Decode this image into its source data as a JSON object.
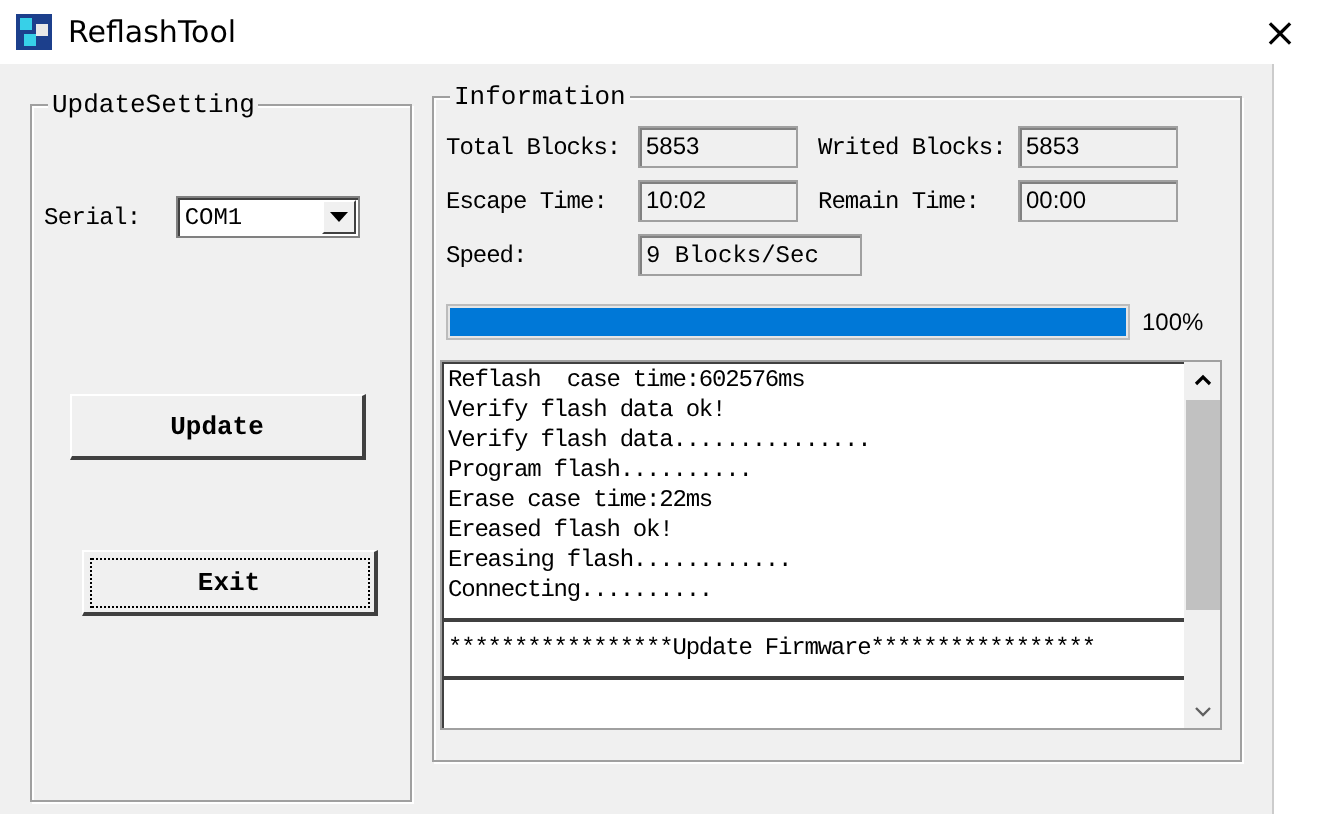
{
  "window": {
    "title": "ReflashTool",
    "close": "×"
  },
  "update_setting": {
    "title": "UpdateSetting",
    "serial_label": "Serial:",
    "serial_value": "COM1",
    "buttons": [
      {
        "label": "Update",
        "focused": false
      },
      {
        "label": "Exit",
        "focused": true
      }
    ]
  },
  "information": {
    "title": "Information",
    "fields": [
      {
        "label": "Total Blocks:",
        "value": "5853"
      },
      {
        "label": "Writed Blocks:",
        "value": "5853"
      },
      {
        "label": "Escape Time:",
        "value": "10:02"
      },
      {
        "label": "Remain Time:",
        "value": "00:00"
      },
      {
        "label": "Speed:",
        "value": "9 Blocks/Sec"
      }
    ],
    "progress": {
      "level": 1,
      "reading": "100%"
    },
    "log": [
      {
        "kind": "text",
        "text": "Reflash  case time:602576ms"
      },
      {
        "kind": "text",
        "text": "Verify flash data ok!"
      },
      {
        "kind": "text",
        "text": "Verify flash data..............."
      },
      {
        "kind": "text",
        "text": "Program flash.........."
      },
      {
        "kind": "text",
        "text": "Erase case time:22ms"
      },
      {
        "kind": "text",
        "text": "Ereased flash ok!"
      },
      {
        "kind": "text",
        "text": "Ereasing flash............"
      },
      {
        "kind": "text",
        "text": "Connecting.........."
      },
      {
        "kind": "rule"
      },
      {
        "kind": "text",
        "text": "*****************Update Firmware*****************"
      },
      {
        "kind": "rule"
      }
    ]
  }
}
